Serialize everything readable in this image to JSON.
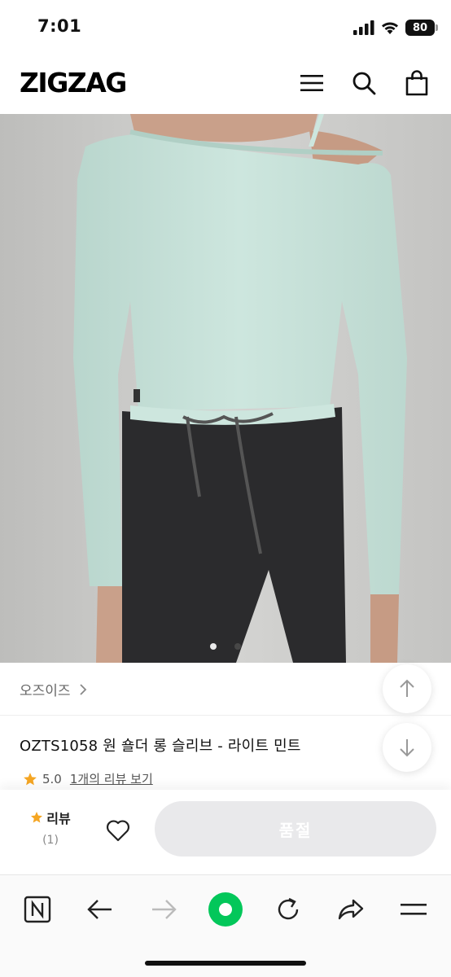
{
  "status_bar": {
    "time": "7:01",
    "battery": "80"
  },
  "header": {
    "logo": "ZIGZAG"
  },
  "product": {
    "brand": "오즈이즈",
    "title": "OZTS1058 원 숄더 롱 슬리브 - 라이트 민트",
    "rating": "5.0",
    "review_link": "1개의 리뷰 보기",
    "image_count": 2,
    "current_image": 1,
    "colors": {
      "top": "#c7e0d8",
      "pants": "#2b2b2d",
      "background": "#c9c9c7"
    }
  },
  "action_bar": {
    "review_label": "리뷰",
    "review_count": "(1)",
    "soldout_label": "품절"
  },
  "icons": {
    "header": [
      "menu-icon",
      "search-icon",
      "shopping-bag-icon"
    ],
    "browser": [
      "naver-n-icon",
      "back-arrow-icon",
      "forward-arrow-icon",
      "green-dot-icon",
      "refresh-icon",
      "share-icon",
      "menu-lines-icon"
    ]
  },
  "accent": {
    "star": "#f5a623",
    "naver_green": "#03c75a"
  }
}
